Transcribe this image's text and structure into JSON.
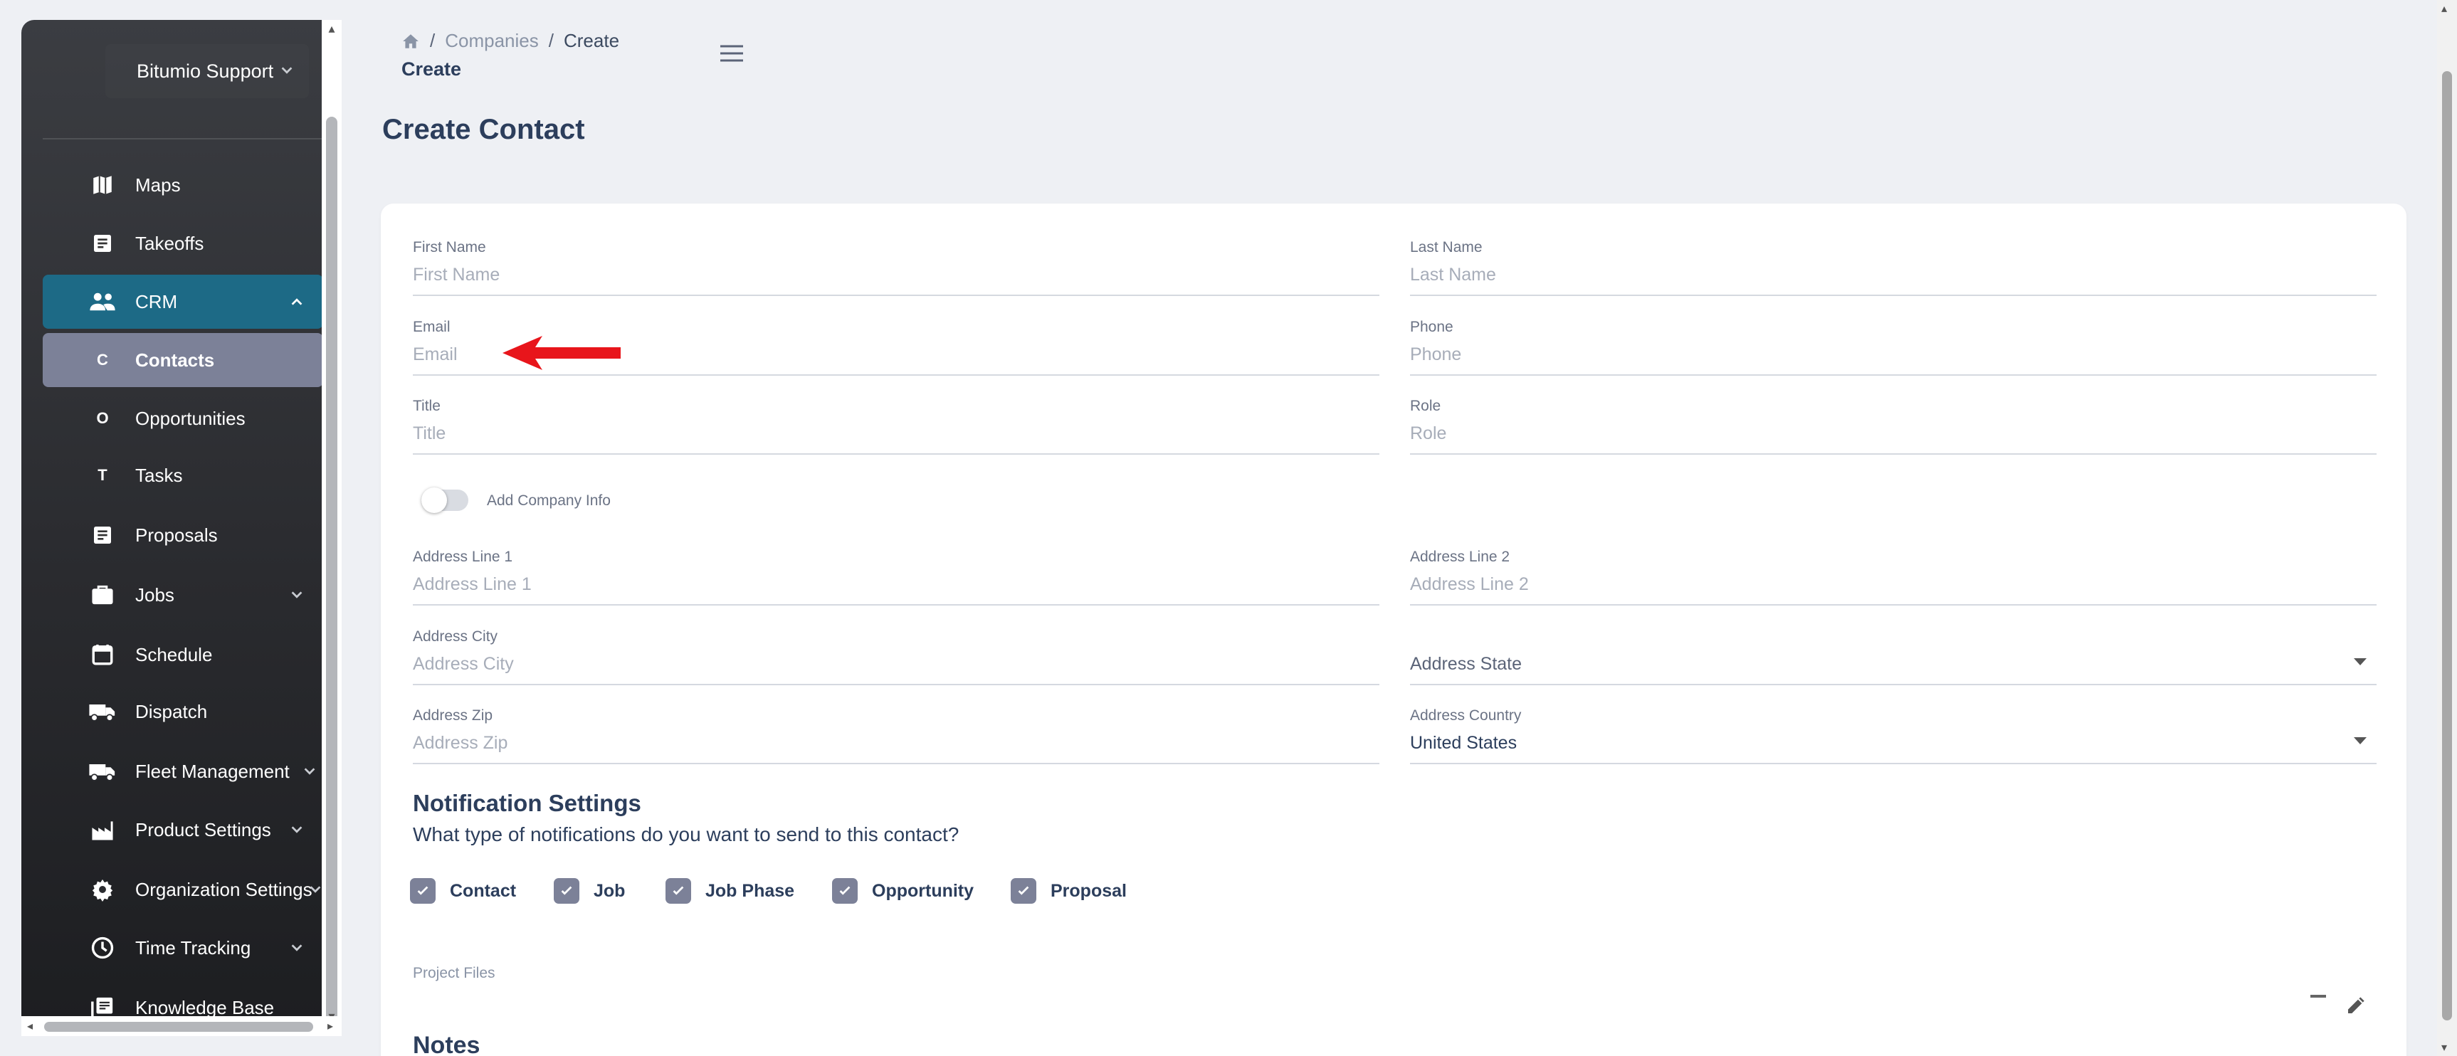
{
  "sidebar": {
    "org_name": "Bitumio Support",
    "items": [
      {
        "label": "Maps",
        "icon": "map-icon"
      },
      {
        "label": "Takeoffs",
        "icon": "document-icon"
      },
      {
        "label": "CRM",
        "icon": "people-icon"
      },
      {
        "label": "Contacts",
        "letter": "C"
      },
      {
        "label": "Opportunities",
        "letter": "O"
      },
      {
        "label": "Tasks",
        "letter": "T"
      },
      {
        "label": "Proposals",
        "icon": "document-icon"
      },
      {
        "label": "Jobs",
        "icon": "briefcase-icon"
      },
      {
        "label": "Schedule",
        "icon": "calendar-icon"
      },
      {
        "label": "Dispatch",
        "icon": "truck-icon"
      },
      {
        "label": "Fleet Management",
        "icon": "truck-icon"
      },
      {
        "label": "Product Settings",
        "icon": "factory-icon"
      },
      {
        "label": "Organization Settings",
        "icon": "gear-icon"
      },
      {
        "label": "Time Tracking",
        "icon": "clock-icon"
      },
      {
        "label": "Knowledge Base",
        "icon": "library-icon"
      }
    ]
  },
  "breadcrumb": {
    "items": [
      "Companies",
      "Create"
    ],
    "sep": "/",
    "title": "Create"
  },
  "page": {
    "title": "Create Contact"
  },
  "form": {
    "first_name": {
      "label": "First Name",
      "placeholder": "First Name"
    },
    "last_name": {
      "label": "Last Name",
      "placeholder": "Last Name"
    },
    "email": {
      "label": "Email",
      "placeholder": "Email"
    },
    "phone": {
      "label": "Phone",
      "placeholder": "Phone"
    },
    "title": {
      "label": "Title",
      "placeholder": "Title"
    },
    "role": {
      "label": "Role",
      "placeholder": "Role"
    },
    "add_company_info": "Add Company Info",
    "address_line1": {
      "label": "Address Line 1",
      "placeholder": "Address Line 1"
    },
    "address_line2": {
      "label": "Address Line 2",
      "placeholder": "Address Line 2"
    },
    "address_city": {
      "label": "Address City",
      "placeholder": "Address City"
    },
    "address_state": {
      "label": "Address State"
    },
    "address_zip": {
      "label": "Address Zip",
      "placeholder": "Address Zip"
    },
    "address_country": {
      "label": "Address Country",
      "value": "United States"
    }
  },
  "notifications": {
    "title": "Notification Settings",
    "subtitle": "What type of notifications do you want to send to this contact?",
    "options": [
      "Contact",
      "Job",
      "Job Phase",
      "Opportunity",
      "Proposal"
    ]
  },
  "project_files": {
    "label": "Project Files"
  },
  "notes": {
    "title": "Notes"
  },
  "colors": {
    "accent": "#1d6a86",
    "active_child": "#7c8198",
    "annotation_arrow": "#e8151b"
  }
}
